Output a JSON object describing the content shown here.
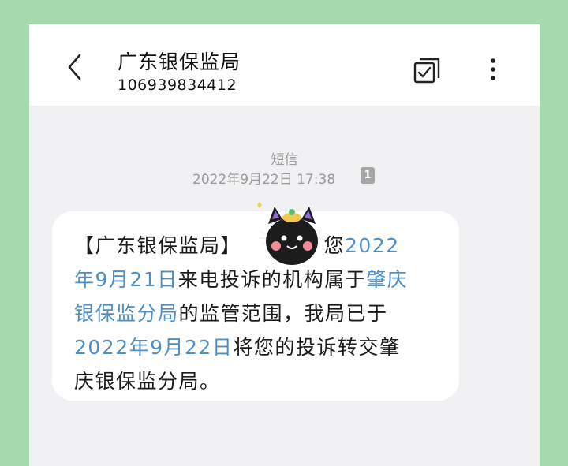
{
  "header": {
    "contact_name": "广东银保监局",
    "contact_number": "106939834412",
    "back_icon": "chevron-left-icon",
    "select_icon": "multi-select-check-icon",
    "more_icon": "more-vertical-icon"
  },
  "thread": {
    "message_type": "短信",
    "timestamp": "2022年9月22日  17:38",
    "sim_badge": "1"
  },
  "message": {
    "part1": "【广东银保监局】",
    "part2": "：您",
    "link_date1": "2022\n年9月21日",
    "part3": "来电投诉的机构属于",
    "link_org1": "肇庆\n银保监分局",
    "part4": "的监管范围，我局已于\n",
    "link_date2": "2022年9月22日",
    "part5": "将您的投诉转交肇\n庆银保监分局。"
  },
  "colors": {
    "background": "#a7d9ae",
    "link": "#4f8fc6",
    "bubble": "#ffffff",
    "screen": "#f1f1f3"
  }
}
